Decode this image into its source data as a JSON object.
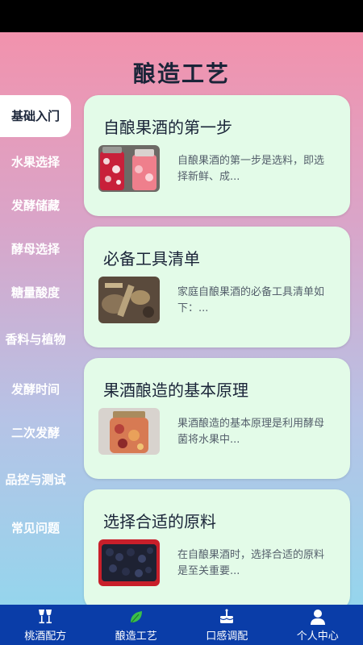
{
  "page": {
    "title": "酿造工艺"
  },
  "sidebar": {
    "items": [
      {
        "label": "基础入门",
        "active": true
      },
      {
        "label": "水果选择"
      },
      {
        "label": "发酵储藏"
      },
      {
        "label": "酵母选择"
      },
      {
        "label": "糖量酸度"
      },
      {
        "label": "香料与植物"
      },
      {
        "label": "发酵时间"
      },
      {
        "label": "二次发酵"
      },
      {
        "label": "品控与测试"
      },
      {
        "label": "常见问题"
      }
    ]
  },
  "articles": [
    {
      "title": "自酿果酒的第一步",
      "desc": "自酿果酒的第一步是选料，即选择新鲜、成...",
      "image": "fruit-jars-image"
    },
    {
      "title": "必备工具清单",
      "desc": "家庭自酿果酒的必备工具清单如下：...",
      "image": "tools-image"
    },
    {
      "title": "果酒酿造的基本原理",
      "desc": "果酒酿造的基本原理是利用酵母菌将水果中...",
      "image": "fruit-jar-image"
    },
    {
      "title": "选择合适的原料",
      "desc": "在自酿果酒时，选择合适的原料是至关重要...",
      "image": "grapes-image"
    }
  ],
  "bottom_nav": {
    "items": [
      {
        "label": "桃酒配方",
        "icon": "wine-glasses-icon"
      },
      {
        "label": "酿造工艺",
        "icon": "leaf-icon"
      },
      {
        "label": "口感调配",
        "icon": "cake-icon"
      },
      {
        "label": "个人中心",
        "icon": "person-icon"
      }
    ]
  },
  "colors": {
    "accent": "#0a3da8",
    "card_bg": "#e3fbe8",
    "title_text": "#1a2438"
  }
}
